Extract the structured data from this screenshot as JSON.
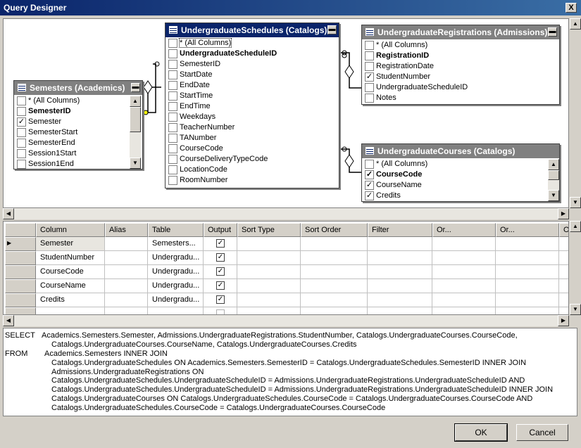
{
  "window": {
    "title": "Query Designer",
    "close_glyph": "X"
  },
  "tables": {
    "semesters": {
      "title": "Semesters (Academics)",
      "rows": [
        {
          "label": "* (All Columns)",
          "checked": false,
          "bold": false
        },
        {
          "label": "SemesterID",
          "checked": false,
          "bold": true
        },
        {
          "label": "Semester",
          "checked": true,
          "bold": false
        },
        {
          "label": "SemesterStart",
          "checked": false,
          "bold": false
        },
        {
          "label": "SemesterEnd",
          "checked": false,
          "bold": false
        },
        {
          "label": "Session1Start",
          "checked": false,
          "bold": false
        },
        {
          "label": "Session1End",
          "checked": false,
          "bold": false
        }
      ]
    },
    "schedules": {
      "title": "UndergraduateSchedules (Catalogs)",
      "rows": [
        {
          "label": "* (All Columns)",
          "checked": false,
          "bold": false
        },
        {
          "label": "UndergraduateScheduleID",
          "checked": false,
          "bold": true
        },
        {
          "label": "SemesterID",
          "checked": false,
          "bold": false
        },
        {
          "label": "StartDate",
          "checked": false,
          "bold": false
        },
        {
          "label": "EndDate",
          "checked": false,
          "bold": false
        },
        {
          "label": "StartTime",
          "checked": false,
          "bold": false
        },
        {
          "label": "EndTime",
          "checked": false,
          "bold": false
        },
        {
          "label": "Weekdays",
          "checked": false,
          "bold": false
        },
        {
          "label": "TeacherNumber",
          "checked": false,
          "bold": false
        },
        {
          "label": "TANumber",
          "checked": false,
          "bold": false
        },
        {
          "label": "CourseCode",
          "checked": false,
          "bold": false
        },
        {
          "label": "CourseDeliveryTypeCode",
          "checked": false,
          "bold": false
        },
        {
          "label": "LocationCode",
          "checked": false,
          "bold": false
        },
        {
          "label": "RoomNumber",
          "checked": false,
          "bold": false
        }
      ]
    },
    "registrations": {
      "title": "UndergraduateRegistrations (Admissions)",
      "rows": [
        {
          "label": "* (All Columns)",
          "checked": false,
          "bold": false
        },
        {
          "label": "RegistrationID",
          "checked": false,
          "bold": true
        },
        {
          "label": "RegistrationDate",
          "checked": false,
          "bold": false
        },
        {
          "label": "StudentNumber",
          "checked": true,
          "bold": false
        },
        {
          "label": "UndergraduateScheduleID",
          "checked": false,
          "bold": false
        },
        {
          "label": "Notes",
          "checked": false,
          "bold": false
        }
      ]
    },
    "courses": {
      "title": "UndergraduateCourses (Catalogs)",
      "rows": [
        {
          "label": "* (All Columns)",
          "checked": false,
          "bold": false
        },
        {
          "label": "CourseCode",
          "checked": true,
          "bold": true
        },
        {
          "label": "CourseName",
          "checked": true,
          "bold": false
        },
        {
          "label": "Credits",
          "checked": true,
          "bold": false
        }
      ]
    }
  },
  "grid": {
    "headers": [
      "Column",
      "Alias",
      "Table",
      "Output",
      "Sort Type",
      "Sort Order",
      "Filter",
      "Or...",
      "Or...",
      "O"
    ],
    "rows": [
      {
        "column": "Semester",
        "alias": "",
        "table": "Semesters...",
        "output": true
      },
      {
        "column": "StudentNumber",
        "alias": "",
        "table": "Undergradu...",
        "output": true
      },
      {
        "column": "CourseCode",
        "alias": "",
        "table": "Undergradu...",
        "output": true
      },
      {
        "column": "CourseName",
        "alias": "",
        "table": "Undergradu...",
        "output": true
      },
      {
        "column": "Credits",
        "alias": "",
        "table": "Undergradu...",
        "output": true
      }
    ]
  },
  "sql": {
    "select_kw": "SELECT",
    "from_kw": "FROM",
    "select_lines": [
      "Academics.Semesters.Semester, Admissions.UndergraduateRegistrations.StudentNumber, Catalogs.UndergraduateCourses.CourseCode,",
      "Catalogs.UndergraduateCourses.CourseName, Catalogs.UndergraduateCourses.Credits"
    ],
    "from_lines": [
      "Academics.Semesters INNER JOIN",
      "Catalogs.UndergraduateSchedules ON Academics.Semesters.SemesterID = Catalogs.UndergraduateSchedules.SemesterID INNER JOIN",
      "Admissions.UndergraduateRegistrations ON",
      "Catalogs.UndergraduateSchedules.UndergraduateScheduleID = Admissions.UndergraduateRegistrations.UndergraduateScheduleID AND",
      "Catalogs.UndergraduateSchedules.UndergraduateScheduleID = Admissions.UndergraduateRegistrations.UndergraduateScheduleID INNER JOIN",
      "Catalogs.UndergraduateCourses ON Catalogs.UndergraduateSchedules.CourseCode = Catalogs.UndergraduateCourses.CourseCode AND",
      "Catalogs.UndergraduateSchedules.CourseCode = Catalogs.UndergraduateCourses.CourseCode"
    ]
  },
  "buttons": {
    "ok": "OK",
    "cancel": "Cancel"
  },
  "glyphs": {
    "check": "✓",
    "minimize": "▬",
    "up": "▲",
    "down": "▼",
    "left": "◀",
    "right": "▶",
    "current_row": "▶"
  }
}
